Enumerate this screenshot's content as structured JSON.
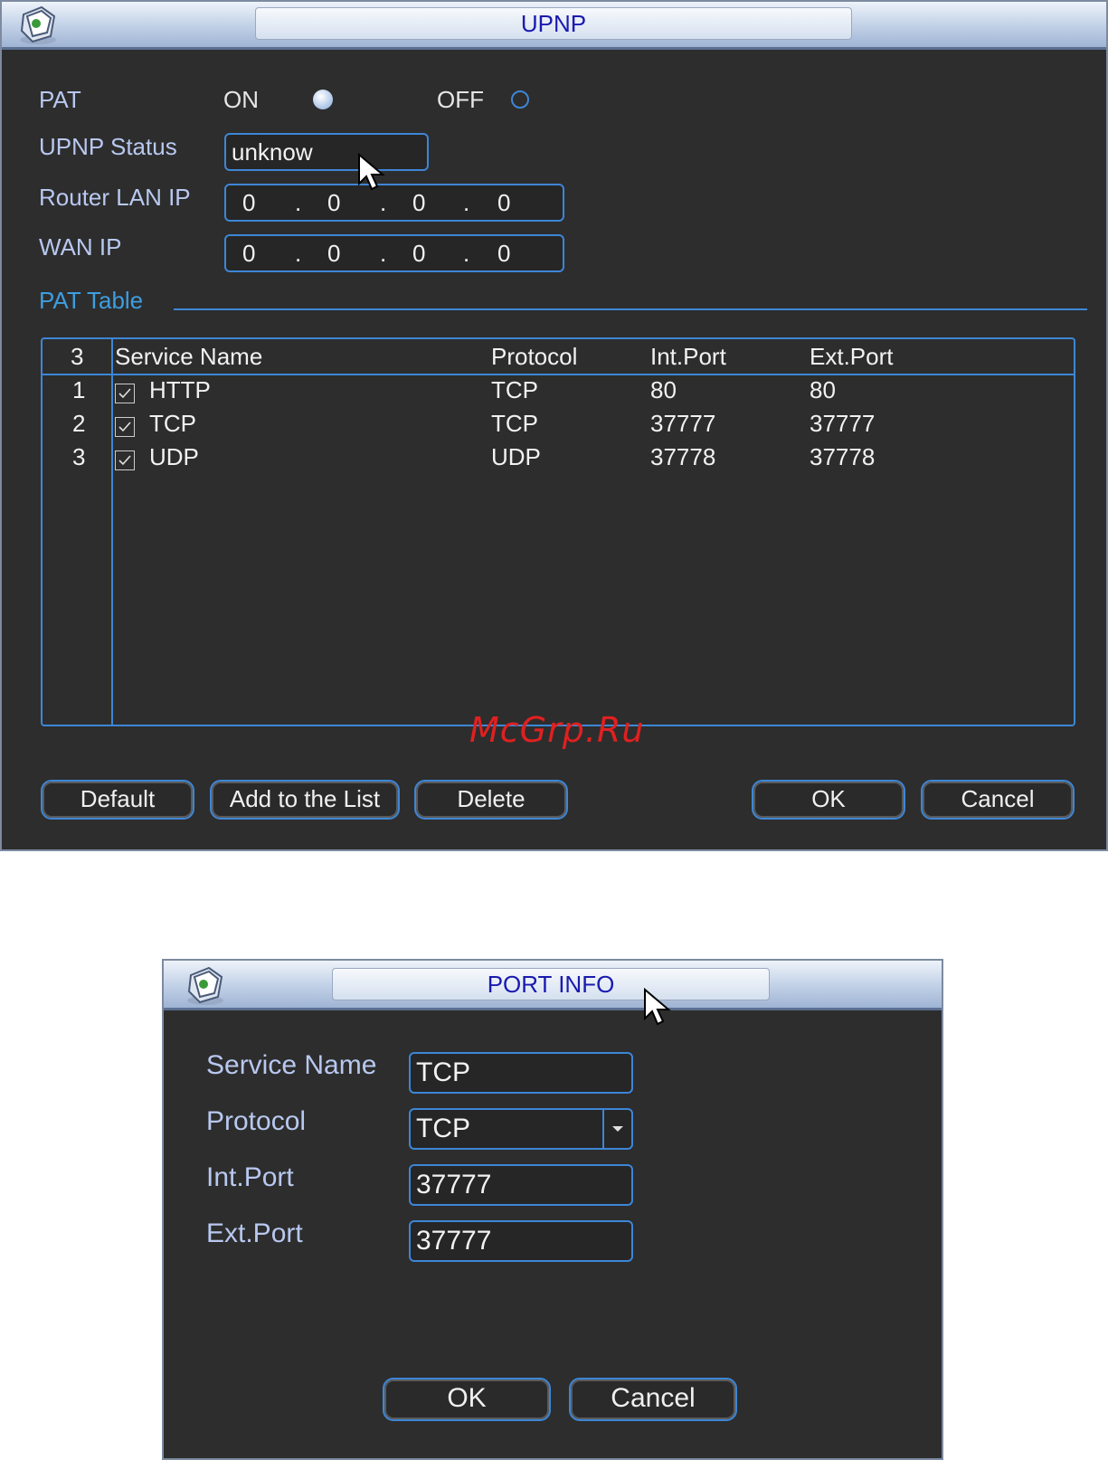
{
  "upnp": {
    "title": "UPNP",
    "pat_label": "PAT",
    "on_label": "ON",
    "off_label": "OFF",
    "pat_selected": "ON",
    "status_label": "UPNP Status",
    "status_value": "unknow",
    "router_lan_ip_label": "Router LAN IP",
    "router_lan_ip": [
      "0",
      "0",
      "0",
      "0"
    ],
    "wan_ip_label": "WAN IP",
    "wan_ip": [
      "0",
      "0",
      "0",
      "0"
    ],
    "pat_table_label": "PAT Table",
    "table": {
      "count": "3",
      "headers": [
        "Service Name",
        "Protocol",
        "Int.Port",
        "Ext.Port"
      ],
      "rows": [
        {
          "num": "1",
          "checked": true,
          "service": "HTTP",
          "protocol": "TCP",
          "int_port": "80",
          "ext_port": "80"
        },
        {
          "num": "2",
          "checked": true,
          "service": "TCP",
          "protocol": "TCP",
          "int_port": "37777",
          "ext_port": "37777"
        },
        {
          "num": "3",
          "checked": true,
          "service": "UDP",
          "protocol": "UDP",
          "int_port": "37778",
          "ext_port": "37778"
        }
      ]
    },
    "buttons": {
      "default": "Default",
      "add": "Add to the List",
      "delete": "Delete",
      "ok": "OK",
      "cancel": "Cancel"
    }
  },
  "watermark": "McGrp.Ru",
  "port_info": {
    "title": "PORT INFO",
    "service_name_label": "Service Name",
    "service_name_value": "TCP",
    "protocol_label": "Protocol",
    "protocol_value": "TCP",
    "int_port_label": "Int.Port",
    "int_port_value": "37777",
    "ext_port_label": "Ext.Port",
    "ext_port_value": "37777",
    "buttons": {
      "ok": "OK",
      "cancel": "Cancel"
    }
  },
  "colors": {
    "accent_blue": "#3d86d6",
    "label_blue": "#b8c8f0",
    "section_blue": "#3d9ee0",
    "title_text": "#1a1ab0",
    "watermark_red": "#e02020",
    "panel_bg": "#2d2d2d"
  },
  "icons": [
    "app-logo-icon",
    "mouse-pointer-icon",
    "checkmark-icon",
    "dropdown-arrow-icon"
  ]
}
